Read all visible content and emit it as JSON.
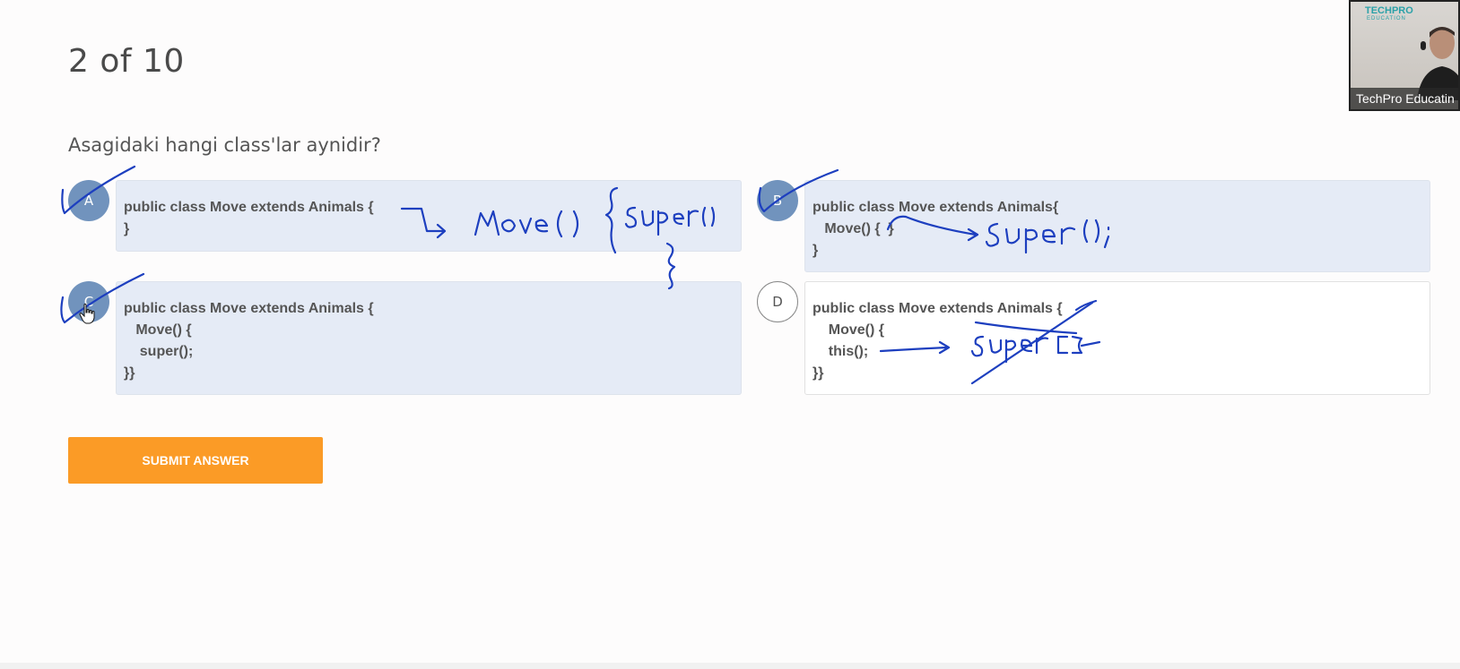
{
  "quiz": {
    "counter": "2 of 10",
    "question": "Asagidaki hangi class'lar aynidir?",
    "submit_label": "SUBMIT ANSWER",
    "options": [
      {
        "letter": "A",
        "selected": true,
        "code": "public class Move extends Animals {\n}"
      },
      {
        "letter": "B",
        "selected": true,
        "code": "public class Move extends Animals{\n   Move() {  }\n}"
      },
      {
        "letter": "C",
        "selected": true,
        "code": "public class Move extends Animals {\n   Move() {\n    super();\n}}"
      },
      {
        "letter": "D",
        "selected": false,
        "code": "public class Move extends Animals {\n    Move() {\n    this();\n}}"
      }
    ]
  },
  "video": {
    "logo": "TECHPRO",
    "logo_sub": "EDUCATION",
    "name": "TechPro Educatin"
  },
  "colors": {
    "accent": "#fb9b26",
    "selected_badge": "#7193bd",
    "selected_card": "#e5ebf6",
    "ink": "#1d3fbf"
  }
}
